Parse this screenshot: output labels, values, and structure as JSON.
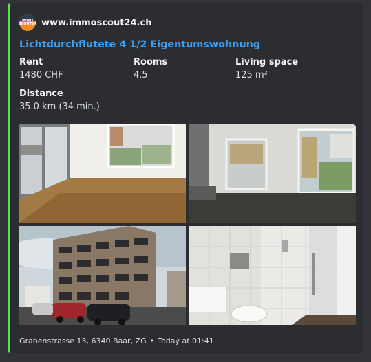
{
  "embed": {
    "accent_color": "#57e34b",
    "author": {
      "icon": "immoscout-logo",
      "icon_text": "IMMO SCOUT24",
      "name": "www.immoscout24.ch"
    },
    "title": "Lichtdurchflutete 4 1/2 Eigentumswohnung",
    "fields": [
      {
        "name": "Rent",
        "value": "1480 CHF"
      },
      {
        "name": "Rooms",
        "value": "4.5"
      },
      {
        "name": "Living space",
        "value": "125 m²"
      },
      {
        "name": "Distance",
        "value": "35.0 km (34 min.)"
      }
    ],
    "images": [
      {
        "icon": "living-room-photo"
      },
      {
        "icon": "empty-room-window-photo"
      },
      {
        "icon": "apartment-building-photo"
      },
      {
        "icon": "bathroom-photo"
      }
    ],
    "footer": {
      "address": "Grabenstrasse 13, 6340 Baar, ZG",
      "separator": "•",
      "timestamp": "Today at 01:41"
    }
  }
}
